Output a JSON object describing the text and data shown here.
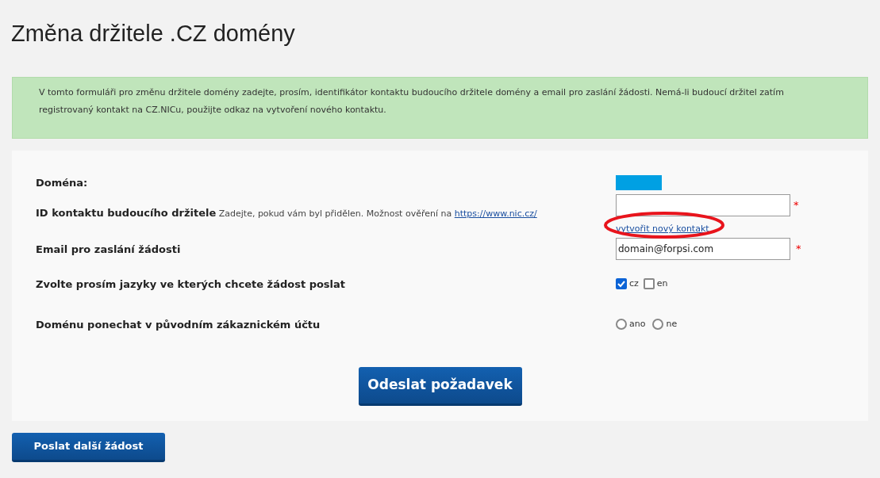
{
  "title": "Změna držitele .CZ domény",
  "info": "V tomto formuláři pro změnu držitele domény zadejte, prosím, identifikátor kontaktu budoucího držitele domény a email pro zaslání žádosti. Nemá-li budoucí držitel zatím registrovaný kontakt na CZ.NICu, použijte odkaz na vytvoření nového kontaktu.",
  "form": {
    "domain_label": "Doména:",
    "contact_label": "ID kontaktu budoucího držitele",
    "contact_hint": "Zadejte, pokud vám byl přidělen. Možnost ověření na",
    "contact_hint_link": "https://www.nic.cz/",
    "contact_required": "*",
    "new_contact_link": "vytvořit nový kontakt",
    "email_label": "Email pro zaslání žádosti",
    "email_value": "domain@forpsi.com",
    "email_required": "*",
    "languages_label": "Zvolte prosím jazyky ve kterých chcete žádost poslat",
    "languages": [
      {
        "label": "cz",
        "checked": true
      },
      {
        "label": "en",
        "checked": false
      }
    ],
    "keep_label": "Doménu ponechat v původním zákaznickém účtu",
    "keep_options": [
      {
        "label": "ano",
        "selected": false
      },
      {
        "label": "ne",
        "selected": false
      }
    ],
    "submit": "Odeslat požadavek"
  },
  "another_button": "Poslat další žádost"
}
